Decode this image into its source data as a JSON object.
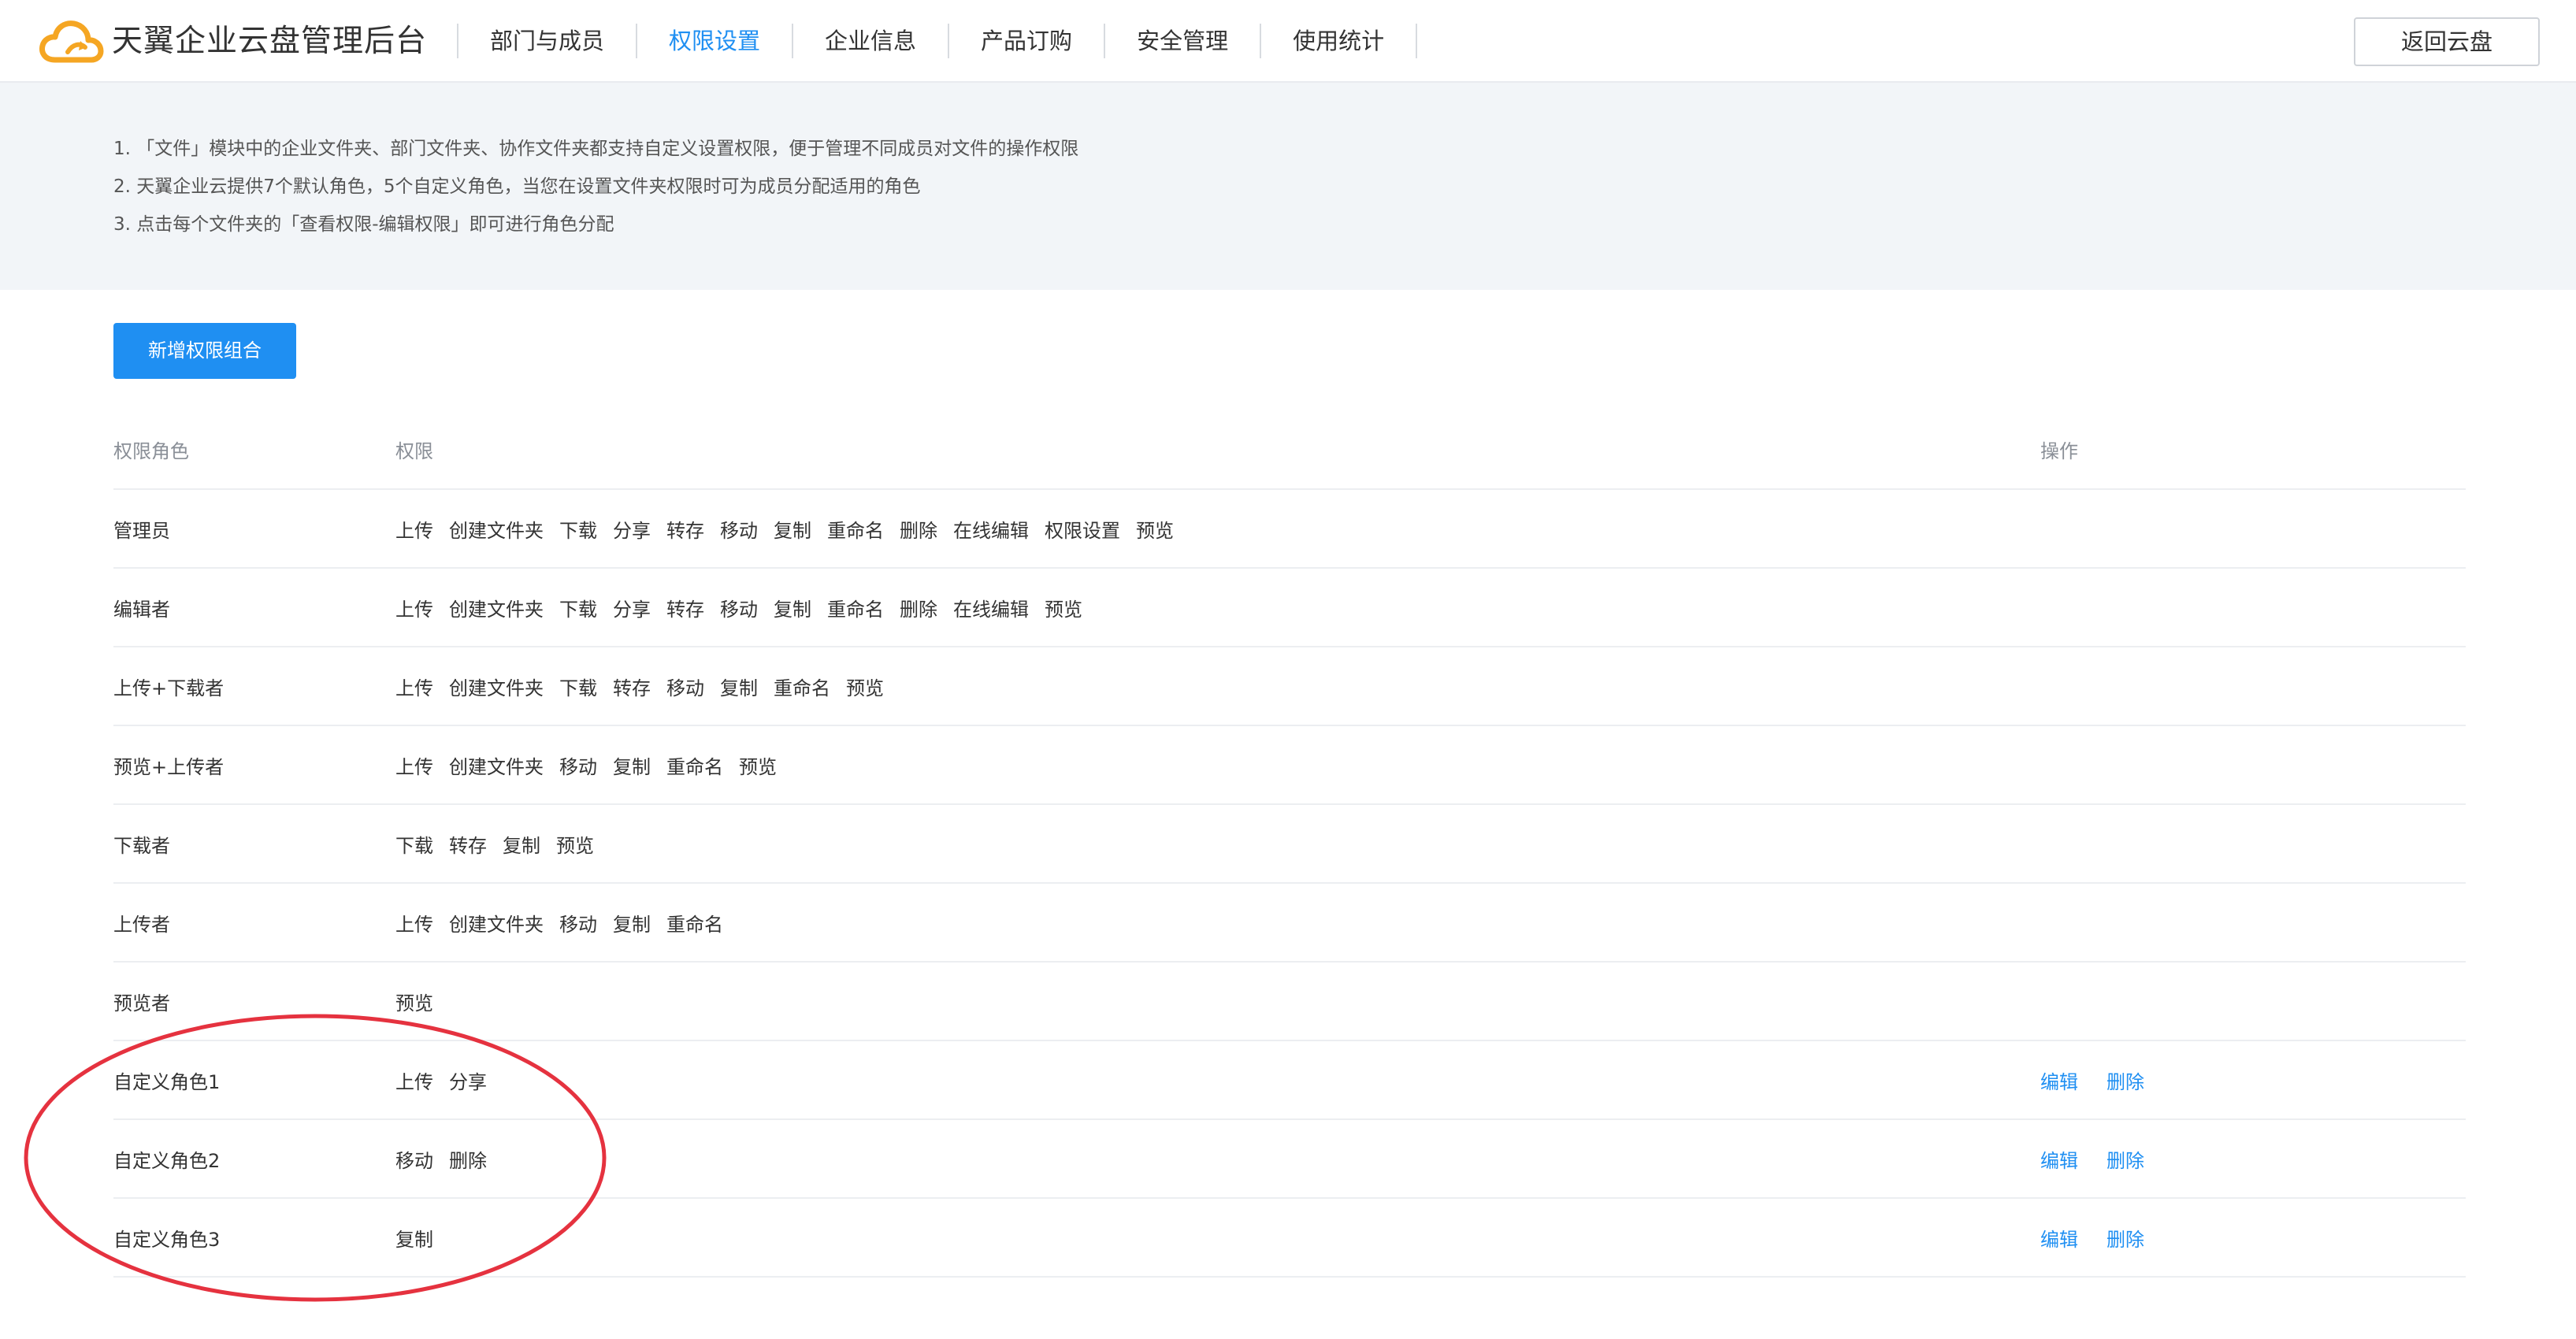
{
  "header": {
    "brand": "天翼企业云盘管理后台",
    "nav": [
      "部门与成员",
      "权限设置",
      "企业信息",
      "产品订购",
      "安全管理",
      "使用统计"
    ],
    "active_nav": "权限设置",
    "back_label": "返回云盘"
  },
  "tips": [
    "1. 「文件」模块中的企业文件夹、部门文件夹、协作文件夹都支持自定义设置权限，便于管理不同成员对文件的操作权限",
    "2. 天翼企业云提供7个默认角色，5个自定义角色，当您在设置文件夹权限时可为成员分配适用的角色",
    "3. 点击每个文件夹的「查看权限-编辑权限」即可进行角色分配"
  ],
  "add_button": "新增权限组合",
  "table": {
    "headers": {
      "role": "权限角色",
      "perms": "权限",
      "ops": "操作"
    },
    "rows": [
      {
        "role": "管理员",
        "perms": [
          "上传",
          "创建文件夹",
          "下载",
          "分享",
          "转存",
          "移动",
          "复制",
          "重命名",
          "删除",
          "在线编辑",
          "权限设置",
          "预览"
        ]
      },
      {
        "role": "编辑者",
        "perms": [
          "上传",
          "创建文件夹",
          "下载",
          "分享",
          "转存",
          "移动",
          "复制",
          "重命名",
          "删除",
          "在线编辑",
          "预览"
        ]
      },
      {
        "role": "上传+下载者",
        "perms": [
          "上传",
          "创建文件夹",
          "下载",
          "转存",
          "移动",
          "复制",
          "重命名",
          "预览"
        ]
      },
      {
        "role": "预览+上传者",
        "perms": [
          "上传",
          "创建文件夹",
          "移动",
          "复制",
          "重命名",
          "预览"
        ]
      },
      {
        "role": "下载者",
        "perms": [
          "下载",
          "转存",
          "复制",
          "预览"
        ]
      },
      {
        "role": "上传者",
        "perms": [
          "上传",
          "创建文件夹",
          "移动",
          "复制",
          "重命名"
        ]
      },
      {
        "role": "预览者",
        "perms": [
          "预览"
        ]
      },
      {
        "role": "自定义角色1",
        "perms": [
          "上传",
          "分享"
        ],
        "ops": [
          "编辑",
          "删除"
        ]
      },
      {
        "role": "自定义角色2",
        "perms": [
          "移动",
          "删除"
        ],
        "ops": [
          "编辑",
          "删除"
        ]
      },
      {
        "role": "自定义角色3",
        "perms": [
          "复制"
        ],
        "ops": [
          "编辑",
          "删除"
        ]
      }
    ]
  },
  "colors": {
    "accent": "#1f8ff2",
    "logo_orange": "#f5a623",
    "annotation_red": "#e5323f"
  }
}
